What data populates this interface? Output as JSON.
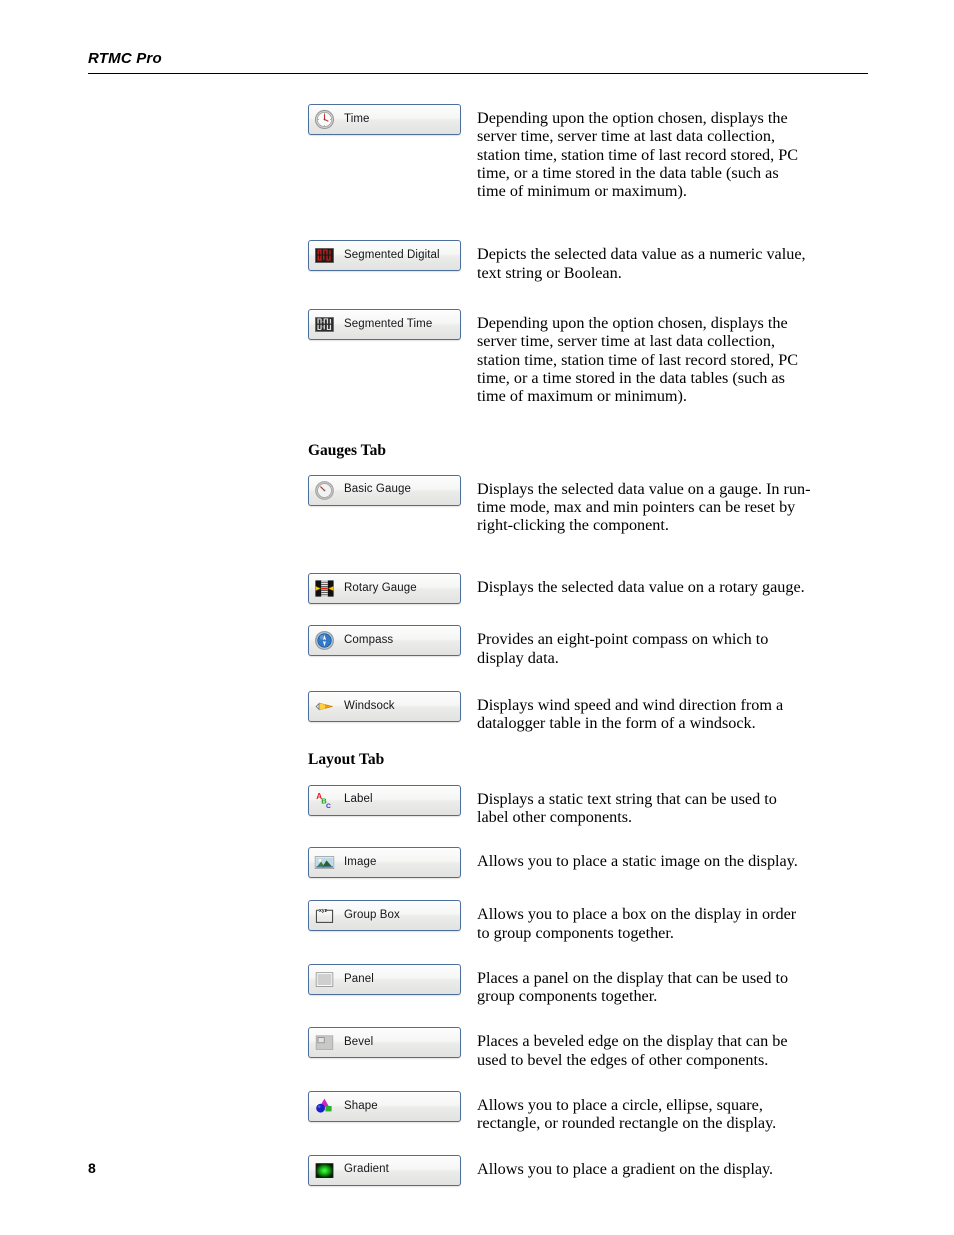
{
  "header": {
    "title": "RTMC Pro"
  },
  "footer": {
    "page_number": "8"
  },
  "headings": {
    "gauges_tab": "Gauges Tab",
    "layout_tab": "Layout Tab"
  },
  "components": [
    {
      "label": "Time",
      "icon": "clock-icon",
      "description": "Depending upon the option chosen, displays the server time, server time at last data collection, station time, station time of last record stored, PC time, or a time stored in the data table (such as time of minimum or maximum)."
    },
    {
      "label": "Segmented Digital",
      "icon": "segmented-digital-icon",
      "description": "Depicts the selected data value as a numeric value, text string or Boolean."
    },
    {
      "label": "Segmented Time",
      "icon": "segmented-time-icon",
      "description": "Depending upon the option chosen, displays the server time, server time at last data collection, station time, station time of last record stored, PC time, or a time stored in the data tables (such as time of maximum or minimum)."
    },
    {
      "label": "Basic Gauge",
      "icon": "basic-gauge-icon",
      "description": "Displays the selected data value on a gauge.  In run-time mode, max and min pointers can be reset by right-clicking the component."
    },
    {
      "label": "Rotary Gauge",
      "icon": "rotary-gauge-icon",
      "description": "Displays the selected data value on a rotary gauge."
    },
    {
      "label": "Compass",
      "icon": "compass-icon",
      "description": "Provides an eight-point compass on which to display data."
    },
    {
      "label": "Windsock",
      "icon": "windsock-icon",
      "description": "Displays wind speed and wind direction from a datalogger table in the form of a windsock."
    },
    {
      "label": "Label",
      "icon": "label-abc-icon",
      "description": "Displays a static text string that can be used to label other components."
    },
    {
      "label": "Image",
      "icon": "image-icon",
      "description": "Allows you to place a static image on the display."
    },
    {
      "label": "Group Box",
      "icon": "group-box-icon",
      "description": "Allows you to place a box on the display in order to group components together."
    },
    {
      "label": "Panel",
      "icon": "panel-icon",
      "description": "Places a panel on the display that can be used to group components together."
    },
    {
      "label": "Bevel",
      "icon": "bevel-icon",
      "description": "Places a beveled edge on the display that can be used to bevel the edges of other components."
    },
    {
      "label": "Shape",
      "icon": "shape-icon",
      "description": "Allows you to place a circle, ellipse, square, rectangle, or rounded rectangle on the display."
    },
    {
      "label": "Gradient",
      "icon": "gradient-icon",
      "description": "Allows you to place a gradient on the display."
    }
  ],
  "colors": {
    "button_border": "#4d6f9e",
    "led_red": "#e01b16",
    "label_a_red": "#e02020",
    "label_b_green": "#20a020",
    "label_c_blue": "#3030dd",
    "windsock_orange": "#f5a000",
    "gradient_green": "#18d018",
    "shape_magenta": "#d020c8",
    "shape_blue": "#1820c8",
    "shape_green": "#30b030"
  }
}
